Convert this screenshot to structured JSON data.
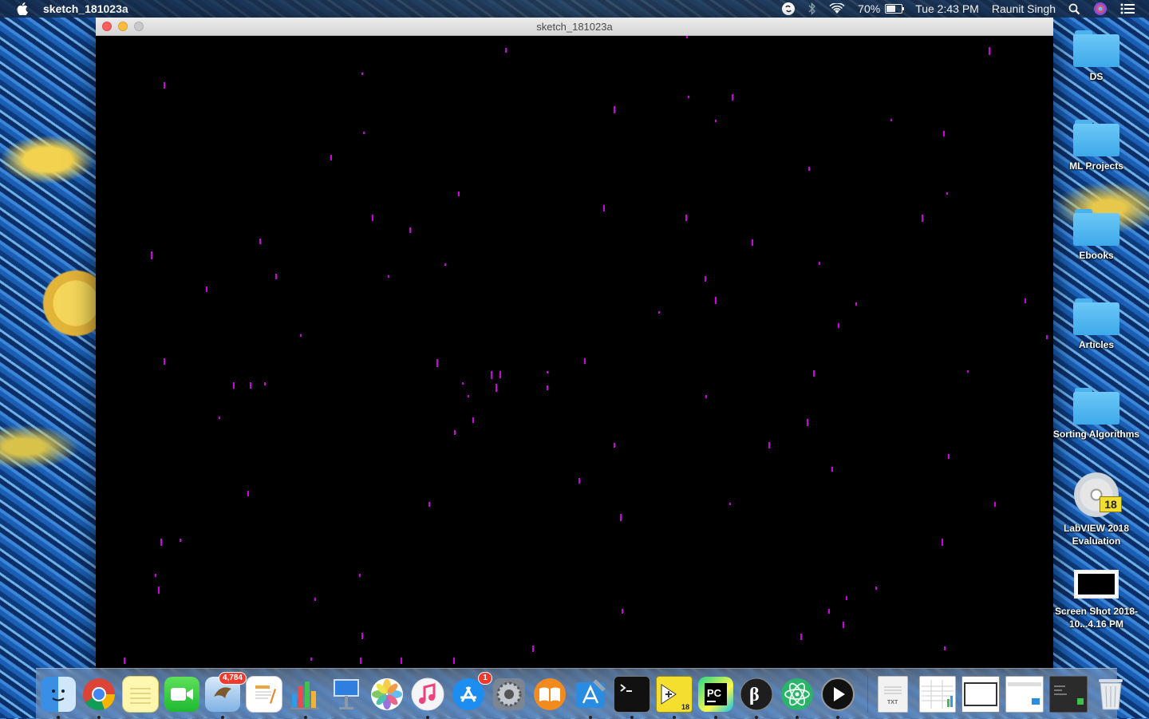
{
  "menubar": {
    "app_name": "sketch_181023a",
    "battery_percent": "70%",
    "battery_level": 0.7,
    "clock": "Tue 2:43 PM",
    "user": "Raunit Singh",
    "icons": [
      "apple-icon",
      "sync-icon",
      "bluetooth-icon",
      "wifi-icon",
      "battery-icon",
      "spotlight-icon",
      "siri-icon",
      "notification-center-icon"
    ]
  },
  "window": {
    "title": "sketch_181023a",
    "canvas_background": "#000000",
    "drop_color": "#d200e6"
  },
  "desktop": {
    "items": [
      {
        "label": "DS",
        "kind": "folder"
      },
      {
        "label": "ML Projects",
        "kind": "folder"
      },
      {
        "label": "Ebooks",
        "kind": "folder"
      },
      {
        "label": "Articles",
        "kind": "folder"
      },
      {
        "label": "Sorting Algorithms",
        "kind": "folder"
      },
      {
        "label": "LabVIEW 2018 Evaluation",
        "kind": "disk-image",
        "badge": "18"
      },
      {
        "label": "Screen Shot 2018-10...4.16 PM",
        "kind": "screenshot"
      }
    ]
  },
  "dock": {
    "apps": [
      {
        "name": "Finder",
        "icon": "finder-icon",
        "running": true
      },
      {
        "name": "Google Chrome",
        "icon": "chrome-icon",
        "running": true
      },
      {
        "name": "Notes",
        "icon": "notes-icon",
        "running": false
      },
      {
        "name": "FaceTime",
        "icon": "facetime-icon",
        "running": false
      },
      {
        "name": "Mail",
        "icon": "mail-icon",
        "running": true,
        "badge": "4,784"
      },
      {
        "name": "Pages",
        "icon": "pages-icon",
        "running": false
      },
      {
        "name": "Numbers",
        "icon": "numbers-icon",
        "running": true
      },
      {
        "name": "Keynote",
        "icon": "keynote-icon",
        "running": false
      },
      {
        "name": "Photos",
        "icon": "photos-icon",
        "running": false
      },
      {
        "name": "iTunes",
        "icon": "itunes-icon",
        "running": true
      },
      {
        "name": "App Store",
        "icon": "app-store-icon",
        "running": false,
        "badge": "1"
      },
      {
        "name": "System Preferences",
        "icon": "system-preferences-icon",
        "running": false
      },
      {
        "name": "iBooks",
        "icon": "ibooks-icon",
        "running": false
      },
      {
        "name": "Xcode",
        "icon": "xcode-icon",
        "running": true
      },
      {
        "name": "Terminal",
        "icon": "terminal-icon",
        "running": true
      },
      {
        "name": "LabVIEW",
        "icon": "labview-icon",
        "running": true,
        "label": "18"
      },
      {
        "name": "PyCharm",
        "icon": "pycharm-icon",
        "running": true
      },
      {
        "name": "Processing",
        "icon": "processing-icon",
        "running": true
      },
      {
        "name": "Atom",
        "icon": "atom-icon",
        "running": true
      },
      {
        "name": "QuickTime Player",
        "icon": "quicktime-icon",
        "running": true
      }
    ],
    "documents": [
      {
        "name": "Text document",
        "icon": "txt-document-icon"
      },
      {
        "name": "Spreadsheet",
        "icon": "spreadsheet-icon"
      },
      {
        "name": "Window preview",
        "icon": "window-preview-icon"
      },
      {
        "name": "Downloads preview",
        "icon": "downloads-preview-icon"
      },
      {
        "name": "Desktop preview",
        "icon": "desktop-preview-icon"
      },
      {
        "name": "Trash",
        "icon": "trash-icon"
      }
    ]
  }
}
